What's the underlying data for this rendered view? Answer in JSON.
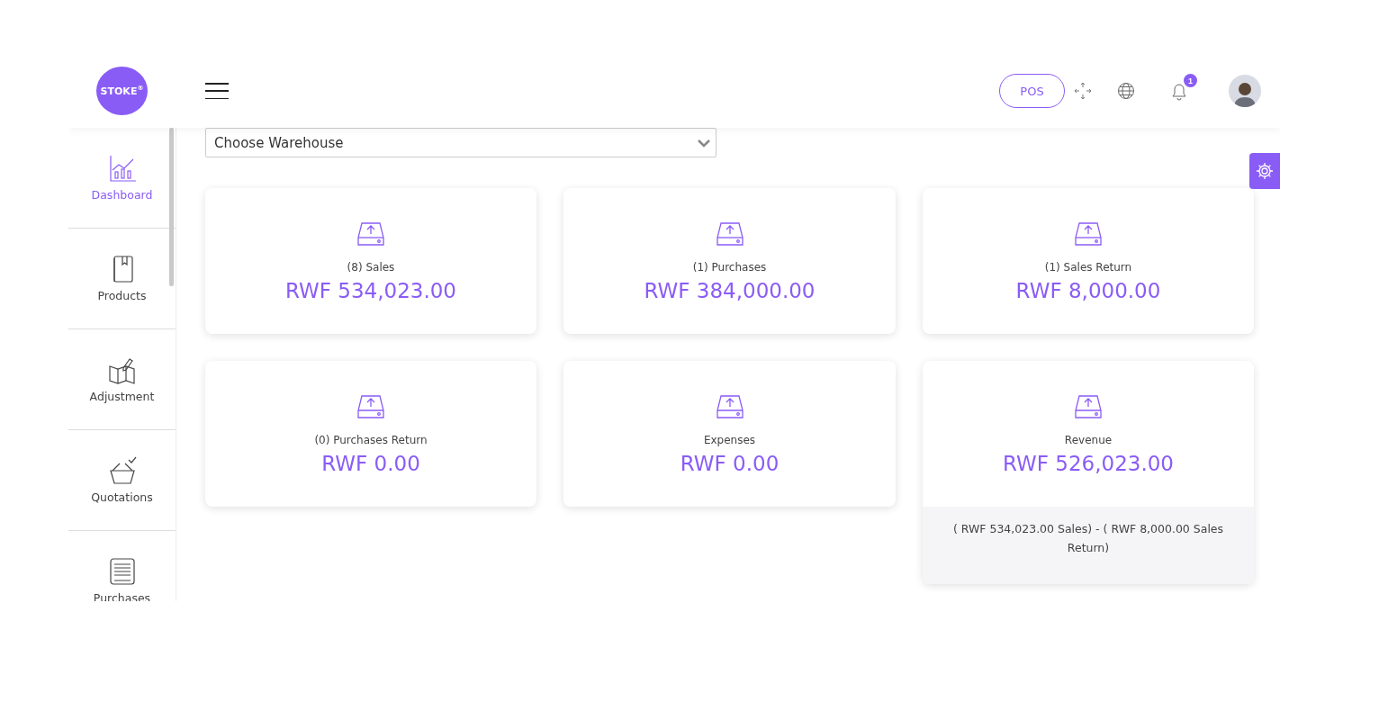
{
  "header": {
    "logo": "STOKE$^{®}$",
    "pos_button": "POS",
    "notification_count": "1"
  },
  "sidebar": {
    "items": [
      {
        "label": "Dashboard",
        "selected": true
      },
      {
        "label": "Products",
        "selected": false
      },
      {
        "label": "Adjustment",
        "selected": false
      },
      {
        "label": "Quotations",
        "selected": false
      },
      {
        "label": "Purchases",
        "selected": false
      }
    ]
  },
  "warehouse_select": {
    "placeholder": "Choose Warehouse"
  },
  "cards": [
    {
      "label": "(8) Sales",
      "value": "RWF 534,023.00"
    },
    {
      "label": "(1) Purchases",
      "value": "RWF 384,000.00"
    },
    {
      "label": "(1) Sales Return",
      "value": "RWF 8,000.00"
    },
    {
      "label": "(0) Purchases Return",
      "value": "RWF 0.00"
    },
    {
      "label": "Expenses",
      "value": "RWF 0.00"
    },
    {
      "label": "Revenue",
      "value": "RWF 526,023.00",
      "note": "( RWF 534,023.00 Sales) - ( RWF 8,000.00 Sales Return)"
    }
  ]
}
